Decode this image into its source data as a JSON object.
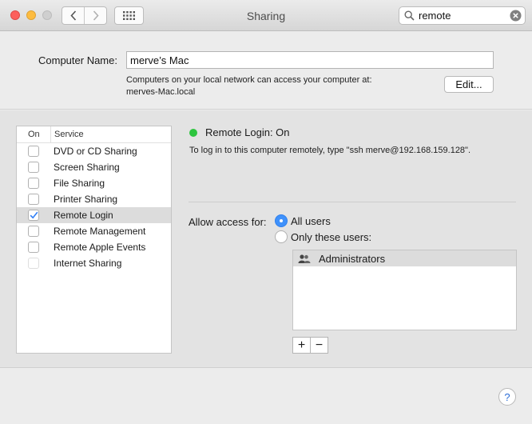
{
  "window": {
    "title": "Sharing"
  },
  "search": {
    "value": "remote"
  },
  "computer_name": {
    "label": "Computer Name:",
    "value": "merve’s Mac",
    "info_line1": "Computers on your local network can access your computer at:",
    "info_line2": "merves-Mac.local",
    "edit_label": "Edit..."
  },
  "services": {
    "header_on": "On",
    "header_service": "Service",
    "items": [
      {
        "label": "DVD or CD Sharing",
        "checked": false
      },
      {
        "label": "Screen Sharing",
        "checked": false
      },
      {
        "label": "File Sharing",
        "checked": false
      },
      {
        "label": "Printer Sharing",
        "checked": false
      },
      {
        "label": "Remote Login",
        "checked": true,
        "selected": true
      },
      {
        "label": "Remote Management",
        "checked": false
      },
      {
        "label": "Remote Apple Events",
        "checked": false
      },
      {
        "label": "Internet Sharing",
        "checked": false,
        "disabled": true
      }
    ]
  },
  "detail": {
    "status": "Remote Login: On",
    "status_color": "#2ec53f",
    "info": "To log in to this computer remotely, type \"ssh merve@192.168.159.128\".",
    "access_label": "Allow access for:",
    "option_all": "All users",
    "option_only": "Only these users:",
    "selected_option": "All users",
    "users": [
      "Administrators"
    ],
    "add_label": "+",
    "remove_label": "−"
  },
  "help": {
    "label": "?"
  },
  "colors": {
    "accent": "#3f91fb"
  }
}
